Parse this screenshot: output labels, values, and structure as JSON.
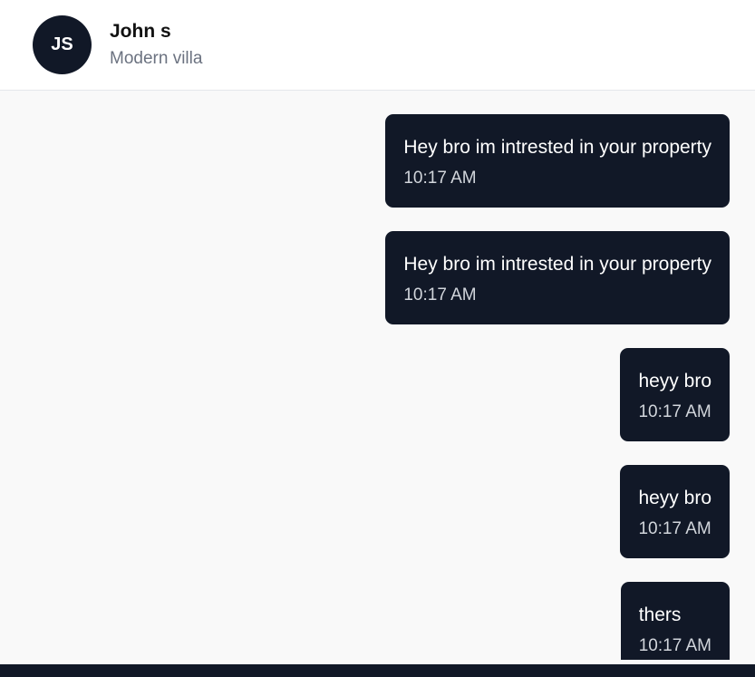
{
  "contact": {
    "initials": "JS",
    "name": "John s",
    "subtitle": "Modern villa"
  },
  "messages": [
    {
      "text": "Hey bro im intrested in your property",
      "time": "10:17 AM"
    },
    {
      "text": "Hey bro im intrested in your property",
      "time": "10:17 AM"
    },
    {
      "text": "heyy bro",
      "time": "10:17 AM"
    },
    {
      "text": "heyy bro",
      "time": "10:17 AM"
    },
    {
      "text": "thers",
      "time": "10:17 AM"
    }
  ],
  "colors": {
    "bubble": "#111827",
    "avatar": "#111827",
    "background": "#f9f9f9"
  }
}
